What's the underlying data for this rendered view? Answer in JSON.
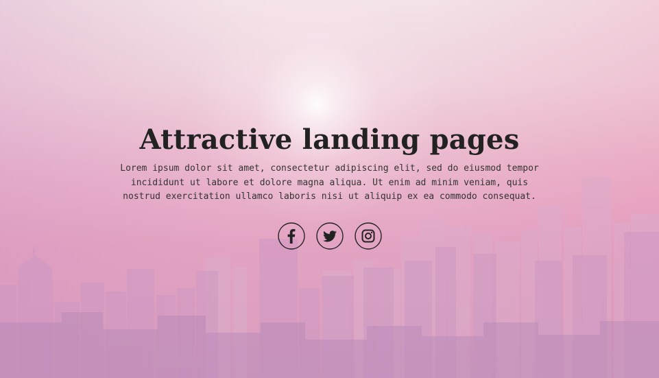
{
  "hero": {
    "title": "Attractive landing pages",
    "text_lines": [
      "Lorem ipsum dolor sit amet, consectetur adipiscing elit, sed do eiusmod tempor",
      "incididunt ut labore et dolore magna aliqua. Ut enim ad minim veniam, quis",
      "nostrud exercitation ullamco laboris nisi ut aliquip ex ea commodo consequat."
    ]
  },
  "social": {
    "icons": [
      "facebook-icon",
      "twitter-icon",
      "instagram-icon"
    ],
    "icon_color": "#222222"
  },
  "colors": {
    "title": "#222222",
    "text": "#333333",
    "sky_top": "#f3e3e8",
    "sky_bottom": "#d99dbd",
    "skyline_far": "#d9a3c4",
    "skyline_mid": "#c995bf",
    "skyline_near": "#b487b5"
  }
}
